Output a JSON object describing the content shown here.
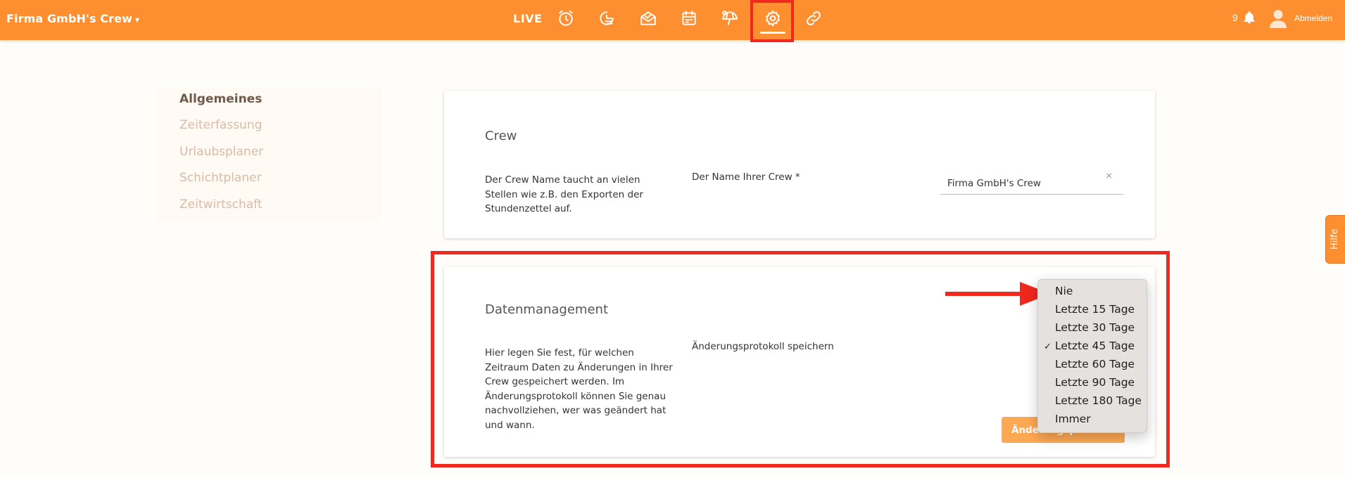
{
  "topbar": {
    "crew_name": "Firma GmbH's Crew",
    "crew_caret": "▾",
    "live_label": "LIVE",
    "nav_icons": [
      "alarm-clock-icon",
      "timer-icon",
      "mail-open-icon",
      "calendar-icon",
      "vacation-icon",
      "gear-icon",
      "link-icon"
    ],
    "active_icon": "gear-icon",
    "notification_count": "9",
    "logout_label": "Abmelden"
  },
  "sidebar": {
    "items": [
      {
        "label": "Allgemeines",
        "active": true
      },
      {
        "label": "Zeiterfassung",
        "active": false
      },
      {
        "label": "Urlaubsplaner",
        "active": false
      },
      {
        "label": "Schichtplaner",
        "active": false
      },
      {
        "label": "Zeitwirtschaft",
        "active": false
      }
    ]
  },
  "crew_card": {
    "title": "Crew",
    "description": "Der Crew Name taucht an vielen Stellen wie z.B. den Exporten der Stundenzettel auf.",
    "field_label": "Der Name Ihrer Crew *",
    "field_value": "Firma GmbH's Crew",
    "clear_symbol": "×"
  },
  "data_card": {
    "title": "Datenmanagement",
    "description": "Hier legen Sie fest, für welchen Zeitraum Daten zu Änderungen in Ihrer Crew gespeichert werden. Im Änderungsprotokoll können Sie genau nachvollziehen, wer was geändert hat und wann.",
    "field_label": "Änderungsprotokoll speichern",
    "button_label": "Änderungsprotokoll"
  },
  "dropdown": {
    "options": [
      "Nie",
      "Letzte 15 Tage",
      "Letzte 30 Tage",
      "Letzte 45 Tage",
      "Letzte 60 Tage",
      "Letzte 90 Tage",
      "Letzte 180 Tage",
      "Immer"
    ],
    "selected": "Letzte 45 Tage",
    "check_symbol": "✓"
  },
  "help": {
    "label": "Hilfe"
  },
  "colors": {
    "brand": "#fe8f31",
    "highlight": "#f0281e",
    "button": "#fda853"
  }
}
